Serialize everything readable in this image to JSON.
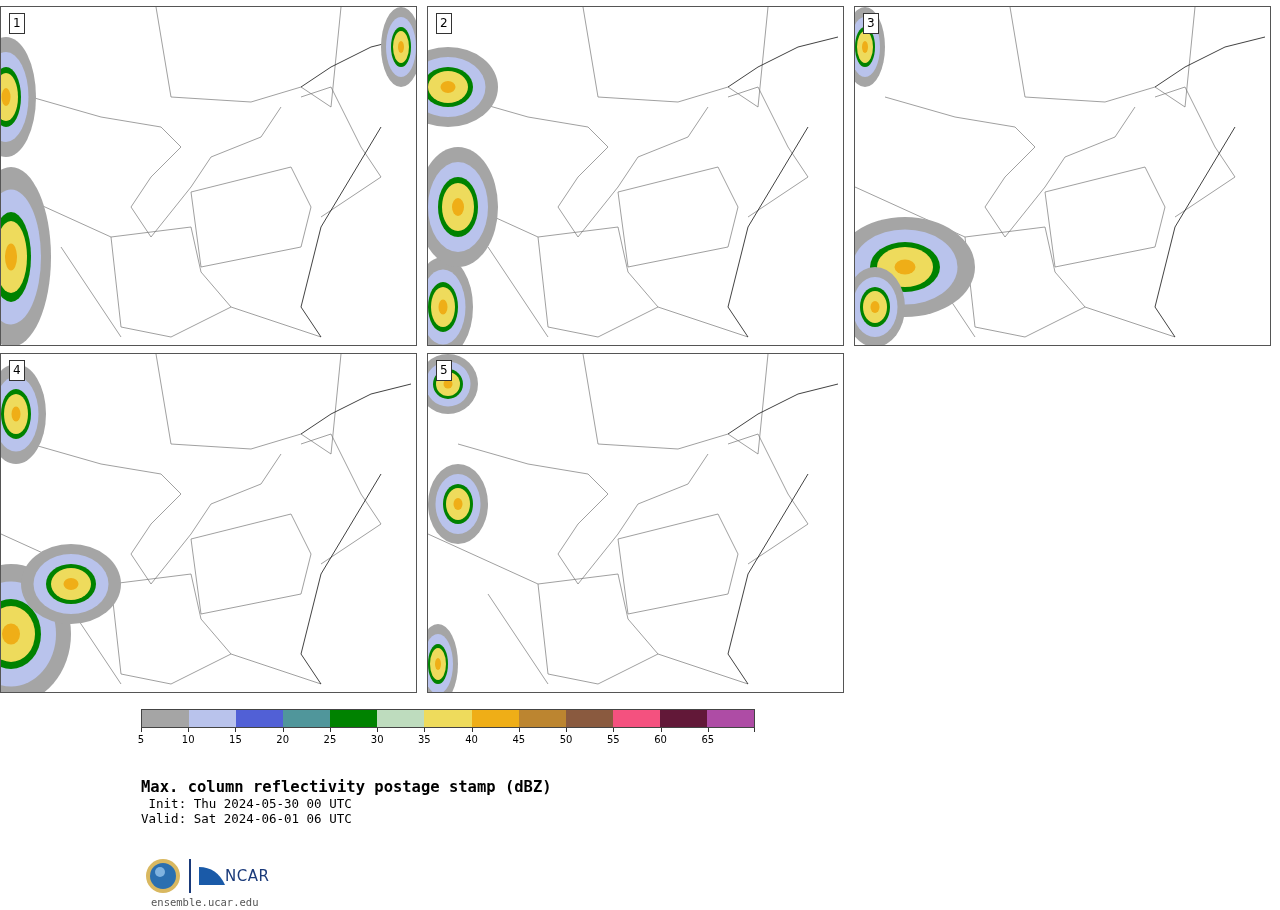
{
  "panels": [
    {
      "label": "1"
    },
    {
      "label": "2"
    },
    {
      "label": "3"
    },
    {
      "label": "4"
    },
    {
      "label": "5"
    }
  ],
  "colorbar": {
    "colors": [
      {
        "color": "#a5a5a5"
      },
      {
        "color": "#b9c3ec"
      },
      {
        "color": "#5160d6"
      },
      {
        "color": "#50969b"
      },
      {
        "color": "#008200"
      },
      {
        "color": "#bedcbe"
      },
      {
        "color": "#eedb5c"
      },
      {
        "color": "#efae17"
      },
      {
        "color": "#bc8530"
      },
      {
        "color": "#8a5a3f"
      },
      {
        "color": "#f4517f"
      },
      {
        "color": "#621838"
      },
      {
        "color": "#ae4ca5"
      }
    ],
    "ticks": [
      "5",
      "10",
      "15",
      "20",
      "25",
      "30",
      "35",
      "40",
      "45",
      "50",
      "55",
      "60",
      "65"
    ]
  },
  "title": "Max. column reflectivity postage stamp (dBZ)",
  "init": " Init: Thu 2024-05-30 00 UTC",
  "valid": "Valid: Sat 2024-06-01 06 UTC",
  "logo": {
    "text": "NCAR"
  },
  "url": "ensemble.ucar.edu"
}
